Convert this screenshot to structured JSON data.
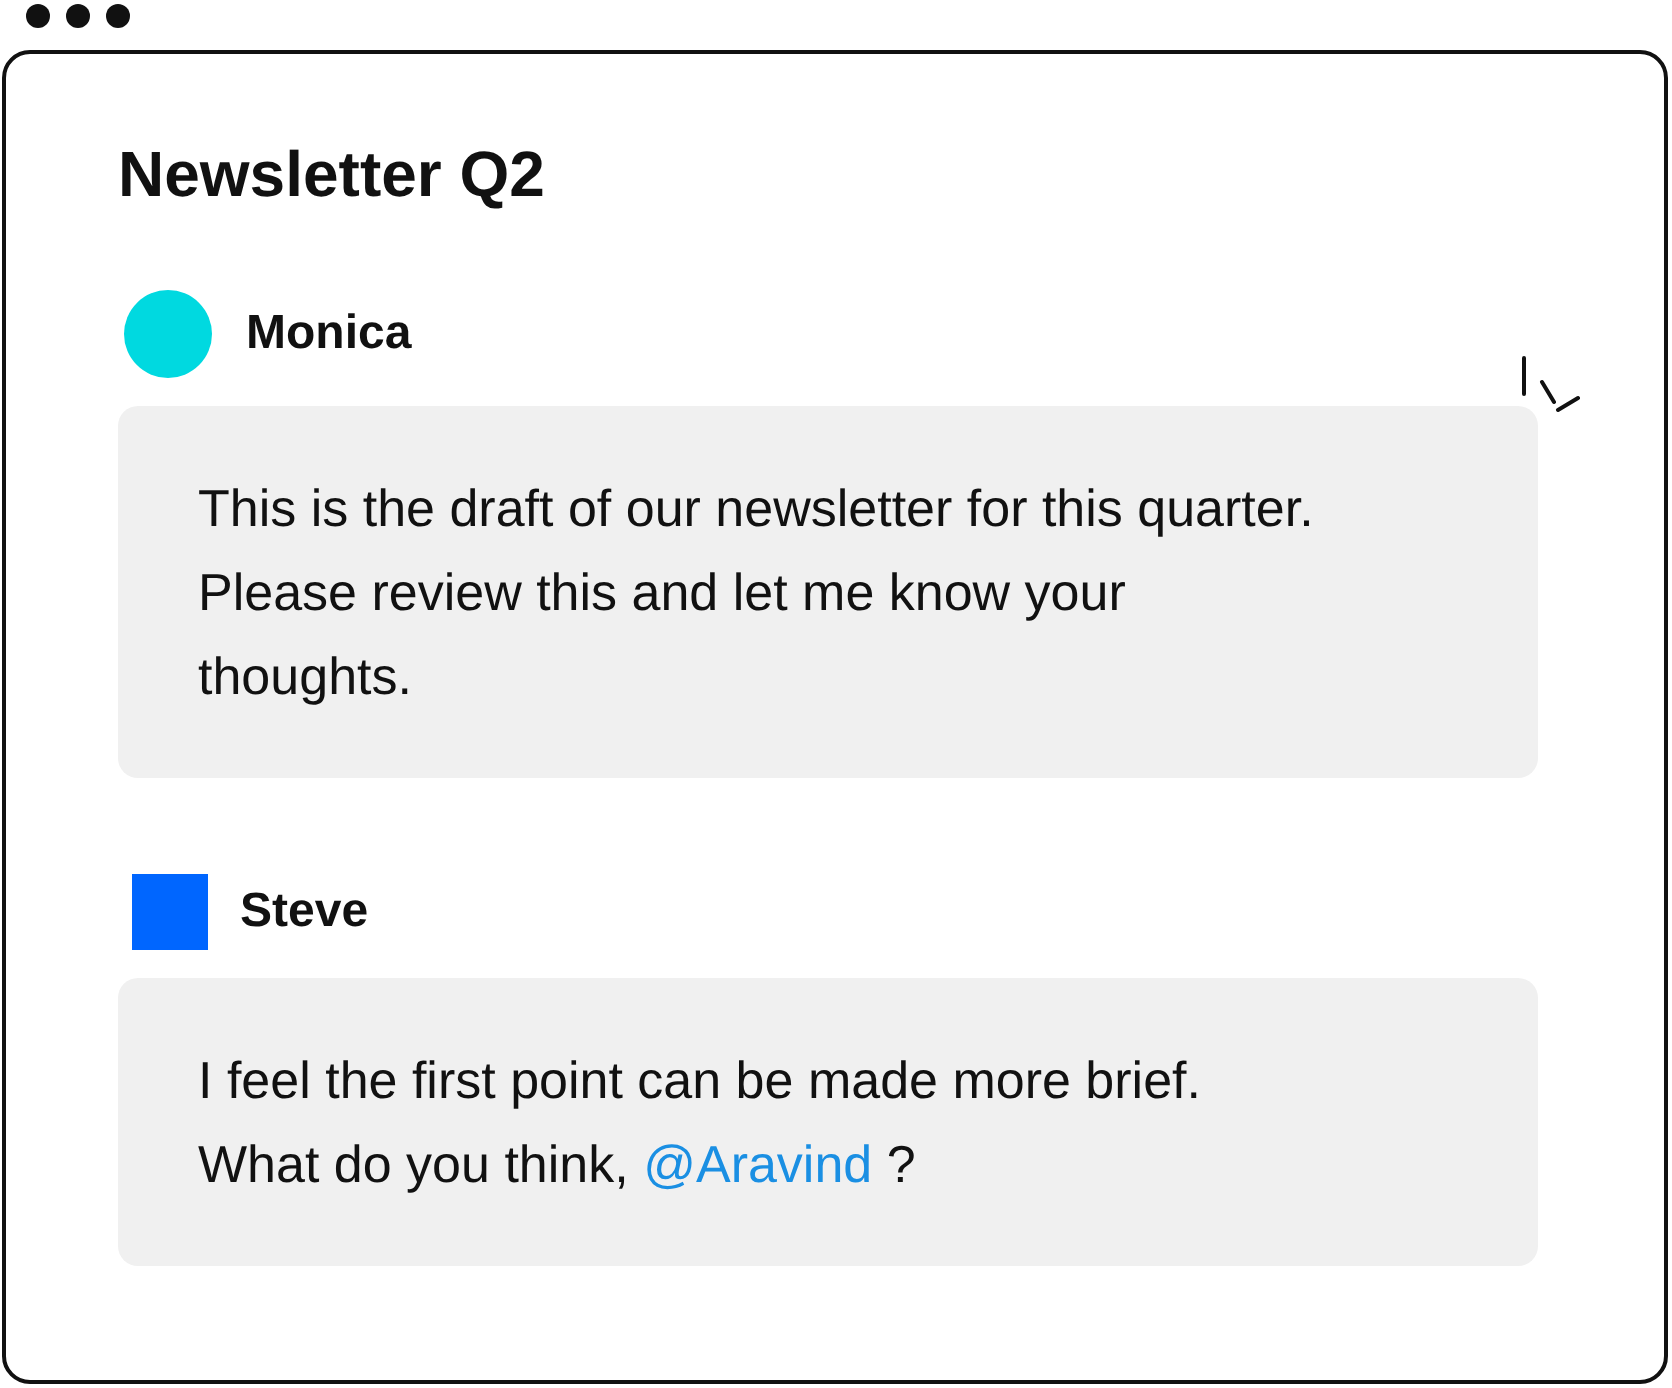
{
  "window": {
    "title": "Newsletter Q2"
  },
  "comments": [
    {
      "kind": "flagged",
      "author": "Monica",
      "avatar": {
        "kind": "circle",
        "color": "#00d9e0"
      },
      "text": "This is the draft of our newsletter for this quarter. Please review this and let me know your thoughts."
    },
    {
      "kind": "plain",
      "author": "Steve",
      "avatar": {
        "kind": "square",
        "color": "#0066ff"
      },
      "text": "I feel the first point can be made more brief. What do you think,",
      "mention": "@Aravind",
      "after": "?"
    }
  ]
}
